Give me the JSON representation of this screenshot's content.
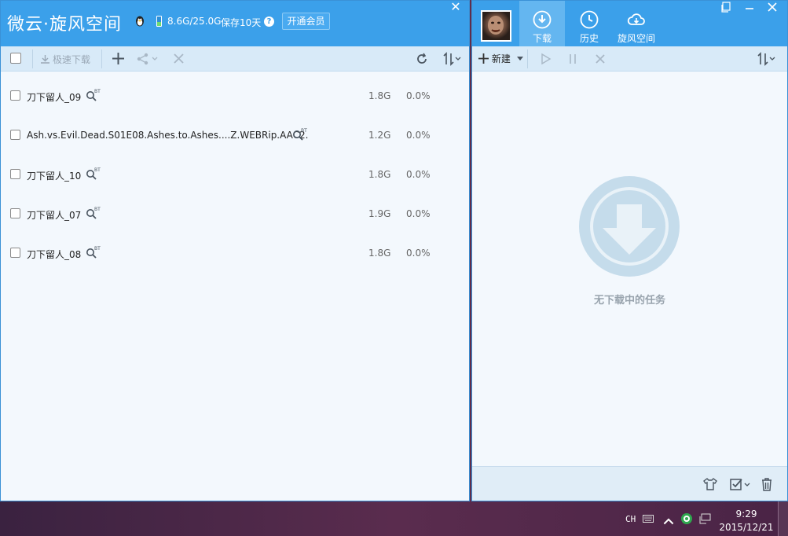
{
  "left_panel": {
    "title": "微云·旋风空间",
    "quota": "8.6G/25.0G",
    "keep": "保存10天",
    "help": "?",
    "vip_button": "开通会员",
    "close": "✕",
    "toolbar": {
      "fast_download": "极速下载"
    },
    "files": [
      {
        "name": "刀下留人_09",
        "size": "1.8G",
        "progress": "0.0%"
      },
      {
        "name": "Ash.vs.Evil.Dead.S01E08.Ashes.to.Ashes....Z.WEBRip.AAC2.",
        "size": "1.2G",
        "progress": "0.0%"
      },
      {
        "name": "刀下留人_10",
        "size": "1.8G",
        "progress": "0.0%"
      },
      {
        "name": "刀下留人_07",
        "size": "1.9G",
        "progress": "0.0%"
      },
      {
        "name": "刀下留人_08",
        "size": "1.8G",
        "progress": "0.0%"
      }
    ]
  },
  "right_panel": {
    "tabs": [
      {
        "label": "下载",
        "icon": "download-icon"
      },
      {
        "label": "历史",
        "icon": "history-icon"
      },
      {
        "label": "旋风空间",
        "icon": "cloud-icon"
      }
    ],
    "new_button": "新建",
    "empty_text": "无下载中的任务"
  },
  "taskbar": {
    "lang": "CH",
    "time": "9:29",
    "date": "2015/12/21"
  },
  "colors": {
    "title_bar": "#3ba0ea",
    "toolbar": "#d8eaf8",
    "panel_bg": "#f3f8fd"
  }
}
